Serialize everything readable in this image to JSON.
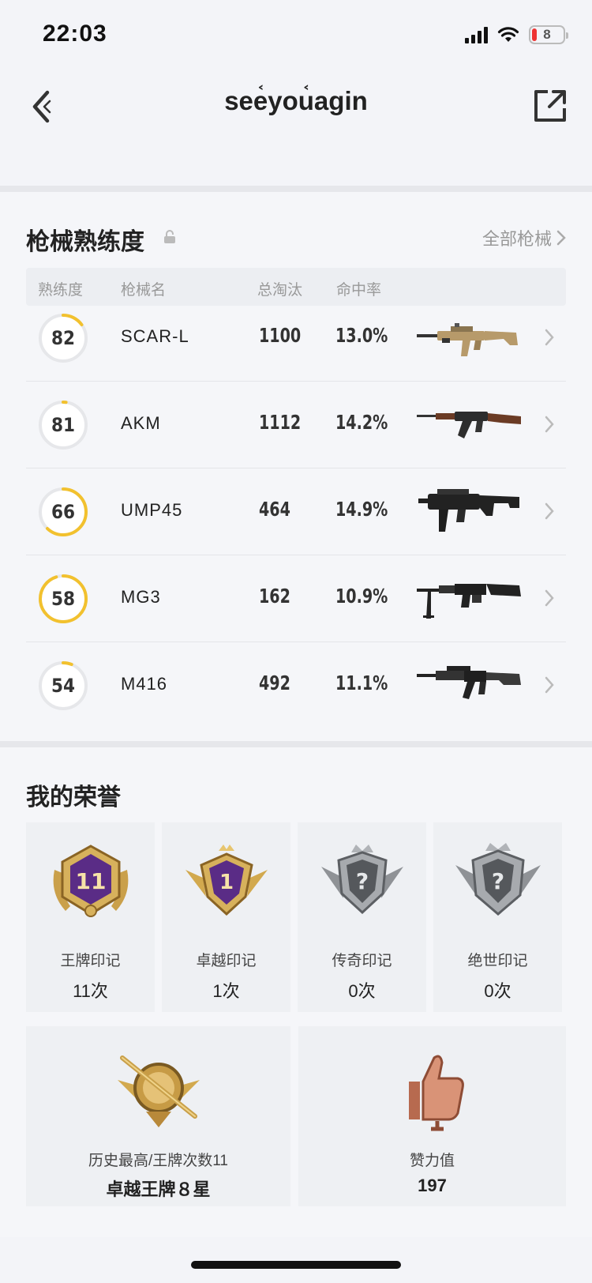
{
  "status_bar": {
    "time": "22:03",
    "battery": "8"
  },
  "nav": {
    "title": "see᷾you᷾agin"
  },
  "weapon_section": {
    "title": "枪械熟练度",
    "all_link": "全部枪械",
    "columns": [
      "熟练度",
      "枪械名",
      "总淘汰",
      "命中率"
    ],
    "rows": [
      {
        "proficiency": "82",
        "ring_fill": 0.15,
        "name": "SCAR-L",
        "kills": "1100",
        "accuracy": "13.0%",
        "image": "scar-l-rifle-icon"
      },
      {
        "proficiency": "81",
        "ring_fill": 0.02,
        "name": "AKM",
        "kills": "1112",
        "accuracy": "14.2%",
        "image": "akm-rifle-icon"
      },
      {
        "proficiency": "66",
        "ring_fill": 0.62,
        "name": "UMP45",
        "kills": "464",
        "accuracy": "14.9%",
        "image": "ump45-smg-icon"
      },
      {
        "proficiency": "58",
        "ring_fill": 0.95,
        "name": "MG3",
        "kills": "162",
        "accuracy": "10.9%",
        "image": "mg3-machinegun-icon"
      },
      {
        "proficiency": "54",
        "ring_fill": 0.06,
        "name": "M416",
        "kills": "492",
        "accuracy": "11.1%",
        "image": "m416-rifle-icon"
      }
    ]
  },
  "honor_section": {
    "title": "我的荣誉",
    "cards": [
      {
        "label": "王牌印记",
        "count": "11次",
        "badge_text": "11"
      },
      {
        "label": "卓越印记",
        "count": "1次",
        "badge_text": "1"
      },
      {
        "label": "传奇印记",
        "count": "0次",
        "badge_text": "?"
      },
      {
        "label": "绝世印记",
        "count": "0次",
        "badge_text": "?"
      }
    ],
    "history": {
      "label": "历史最高/王牌次数11",
      "value": "卓越王牌８星"
    },
    "likes": {
      "label": "赞力值",
      "value": "197"
    }
  },
  "colors": {
    "ring_accent": "#f2c12e",
    "ring_track": "#e6e7ea",
    "gold": "#d8a94a",
    "purple": "#5a2c86"
  }
}
